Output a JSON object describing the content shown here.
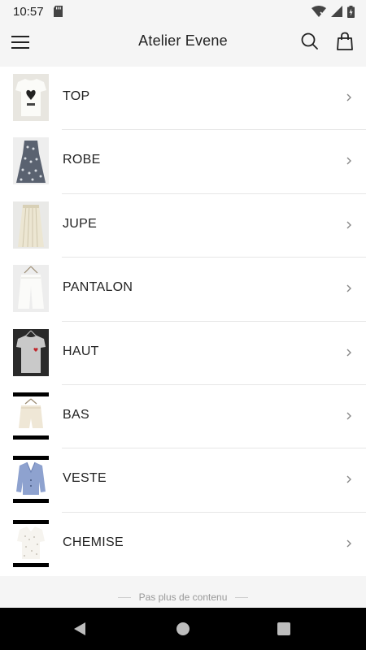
{
  "status_bar": {
    "time": "10:57",
    "icons": [
      "sd-card-icon",
      "wifi-icon",
      "signal-icon",
      "battery-icon"
    ]
  },
  "header": {
    "title": "Atelier Evene",
    "icons": [
      "menu-icon",
      "search-icon",
      "shopping-bag-icon"
    ]
  },
  "categories": [
    {
      "label": "TOP"
    },
    {
      "label": "ROBE"
    },
    {
      "label": "JUPE"
    },
    {
      "label": "PANTALON"
    },
    {
      "label": "HAUT"
    },
    {
      "label": "BAS"
    },
    {
      "label": "VESTE"
    },
    {
      "label": "CHEMISE"
    }
  ],
  "footer": {
    "end_text": "Pas plus de contenu"
  },
  "nav_bar": {
    "icons": [
      "back-icon",
      "home-icon",
      "recents-icon"
    ]
  },
  "colors": {
    "background": "#f5f5f5",
    "list_bg": "#ffffff",
    "text": "#222222",
    "muted": "#999999",
    "nav_bar": "#000000"
  }
}
